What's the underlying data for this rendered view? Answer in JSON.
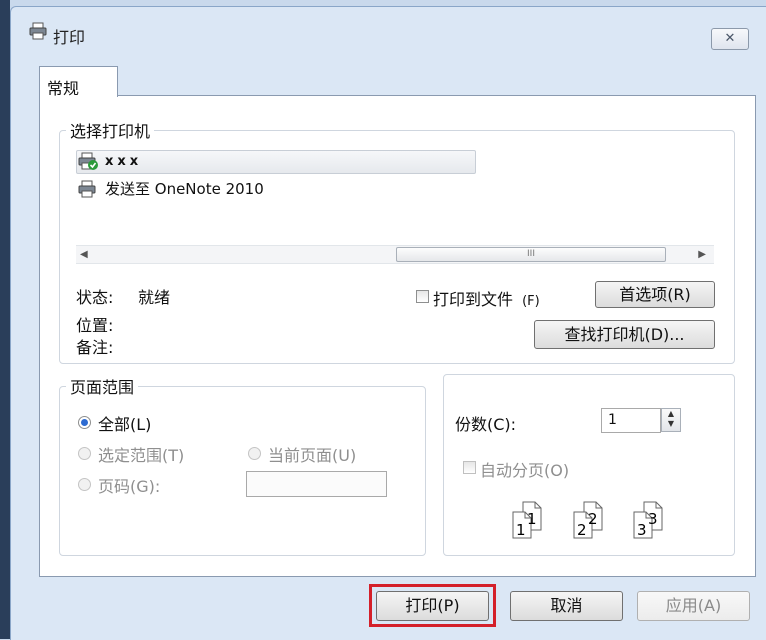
{
  "window": {
    "title": "打印",
    "close_label": "✕"
  },
  "tab": {
    "label": "常规"
  },
  "printer_group": {
    "legend": "选择打印机",
    "printers": [
      {
        "name": "xxx",
        "icon": "printer-default-icon"
      },
      {
        "name": "发送至 OneNote 2010",
        "icon": "printer-icon"
      }
    ],
    "scroll_thumb_glyph": "III",
    "status_label": "状态:",
    "status_value": "就绪",
    "location_label": "位置:",
    "comment_label": "备注:",
    "print_to_file_label": "打印到文件",
    "print_to_file_key": "(F)",
    "preferences_label": "首选项(R)",
    "find_printer_label": "查找打印机(D)..."
  },
  "page_range": {
    "legend": "页面范围",
    "all_label": "全部(L)",
    "selection_label": "选定范围(T)",
    "current_page_label": "当前页面(U)",
    "pages_label": "页码(G):",
    "pages_value": ""
  },
  "copies": {
    "label": "份数(C):",
    "value": "1",
    "collate_label": "自动分页(O)",
    "page_numbers": [
      "1",
      "1",
      "2",
      "2",
      "3",
      "3"
    ]
  },
  "buttons": {
    "print": "打印(P)",
    "cancel": "取消",
    "apply": "应用(A)"
  },
  "colors": {
    "highlight": "#d4202a",
    "radio_selected": "#2d6bd1"
  }
}
